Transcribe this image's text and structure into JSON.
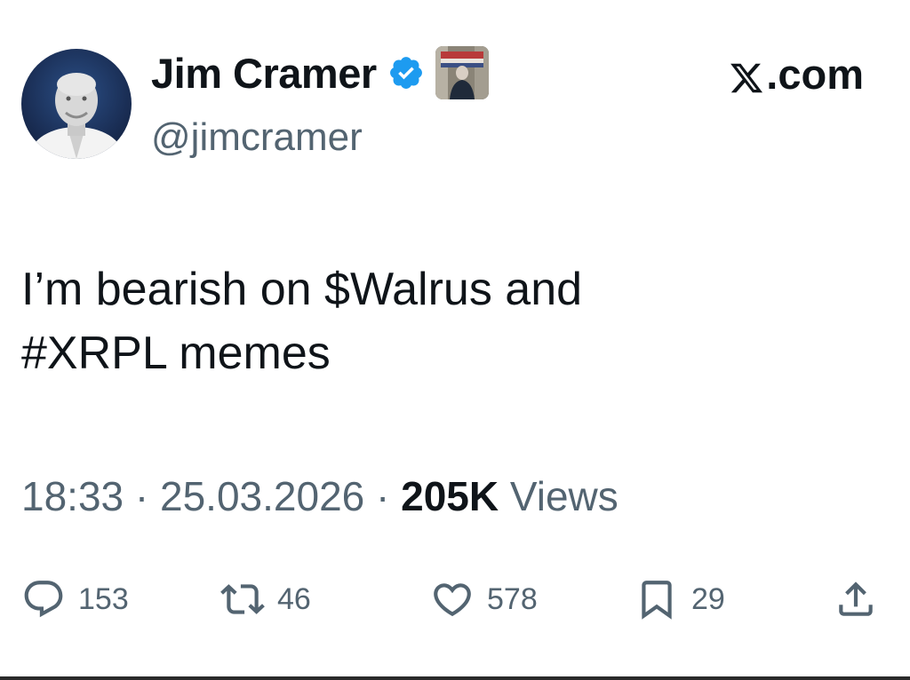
{
  "author": {
    "display_name": "Jim Cramer",
    "handle": "@jimcramer",
    "verified": true
  },
  "source_label": ".com",
  "tweet": {
    "text": "I’m bearish on $Walrus and\n#XRPL memes"
  },
  "meta": {
    "time": "18:33",
    "separator": " · ",
    "date": "25.03.2026",
    "views_count": "205K",
    "views_label": " Views"
  },
  "actions": {
    "replies": "153",
    "reposts": "46",
    "likes": "578",
    "bookmarks": "29"
  },
  "colors": {
    "verified_blue": "#1d9bf0",
    "text_primary": "#0f1419",
    "text_secondary": "#536471"
  },
  "icons": {
    "reply": "speech-bubble-icon",
    "repost": "repost-arrows-icon",
    "like": "heart-icon",
    "bookmark": "bookmark-icon",
    "share": "share-upload-icon"
  }
}
